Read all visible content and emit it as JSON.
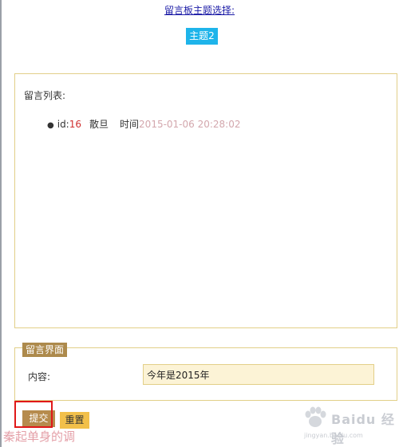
{
  "header": {
    "theme_selector_label": "留言板主题选择:",
    "theme_button_label": "主题2"
  },
  "message_list": {
    "title": "留言列表:",
    "items": [
      {
        "id_label": "id:",
        "id_value": "16",
        "author": "散旦",
        "time_label": "时间",
        "time_value": "2015-01-06 20:28:02"
      }
    ]
  },
  "form": {
    "legend": "留言界面",
    "content_label": "内容:",
    "content_value": "今年是2015年",
    "submit_label": "提交",
    "reset_label": "重置"
  },
  "watermark": {
    "text": "秦起单身的调",
    "brand": "Baidu 经验",
    "url": "jingyan.baidu.com"
  },
  "colors": {
    "theme_button": "#1eb4ea",
    "panel_border": "#e2cf88",
    "submit_button": "#b68b4d",
    "reset_button": "#f2c04a",
    "input_background": "#fcf3d6",
    "id_value": "#d03030",
    "time_value": "#d3a7ad",
    "highlight": "#e01818"
  }
}
